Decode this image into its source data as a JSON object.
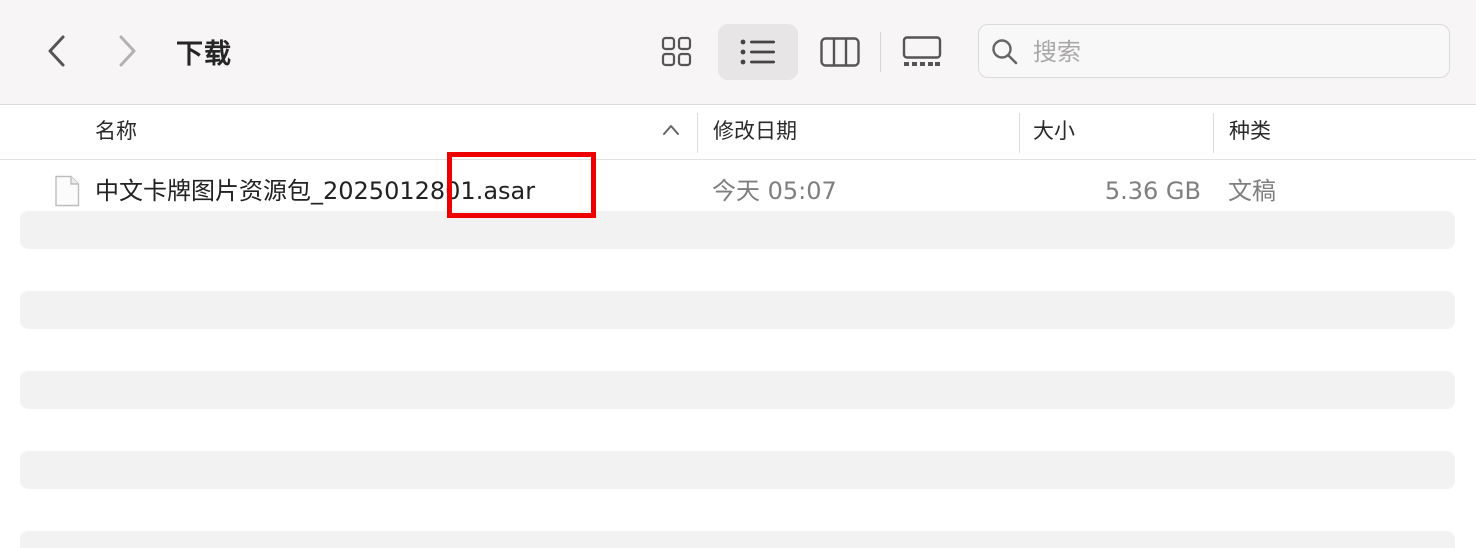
{
  "toolbar": {
    "title": "下载",
    "back_icon": "chevron-left-icon",
    "forward_icon": "chevron-right-icon",
    "views": [
      "icon-view-icon",
      "list-view-icon",
      "column-view-icon",
      "gallery-view-icon"
    ],
    "active_view": "list",
    "search": {
      "placeholder": "搜索",
      "value": ""
    }
  },
  "columns": {
    "name": "名称",
    "modified": "修改日期",
    "size": "大小",
    "kind": "种类",
    "sort_indicator": "chevron-up-icon"
  },
  "files": [
    {
      "name": "中文卡牌图片资源包_2025012801.asar",
      "modified": "今天 05:07",
      "size": "5.36 GB",
      "kind": "文稿",
      "icon": "document-icon"
    }
  ],
  "colors": {
    "toolbar_bg": "#f7f5f6",
    "stripe": "#f3f2f2",
    "highlight": "#ee0000"
  }
}
